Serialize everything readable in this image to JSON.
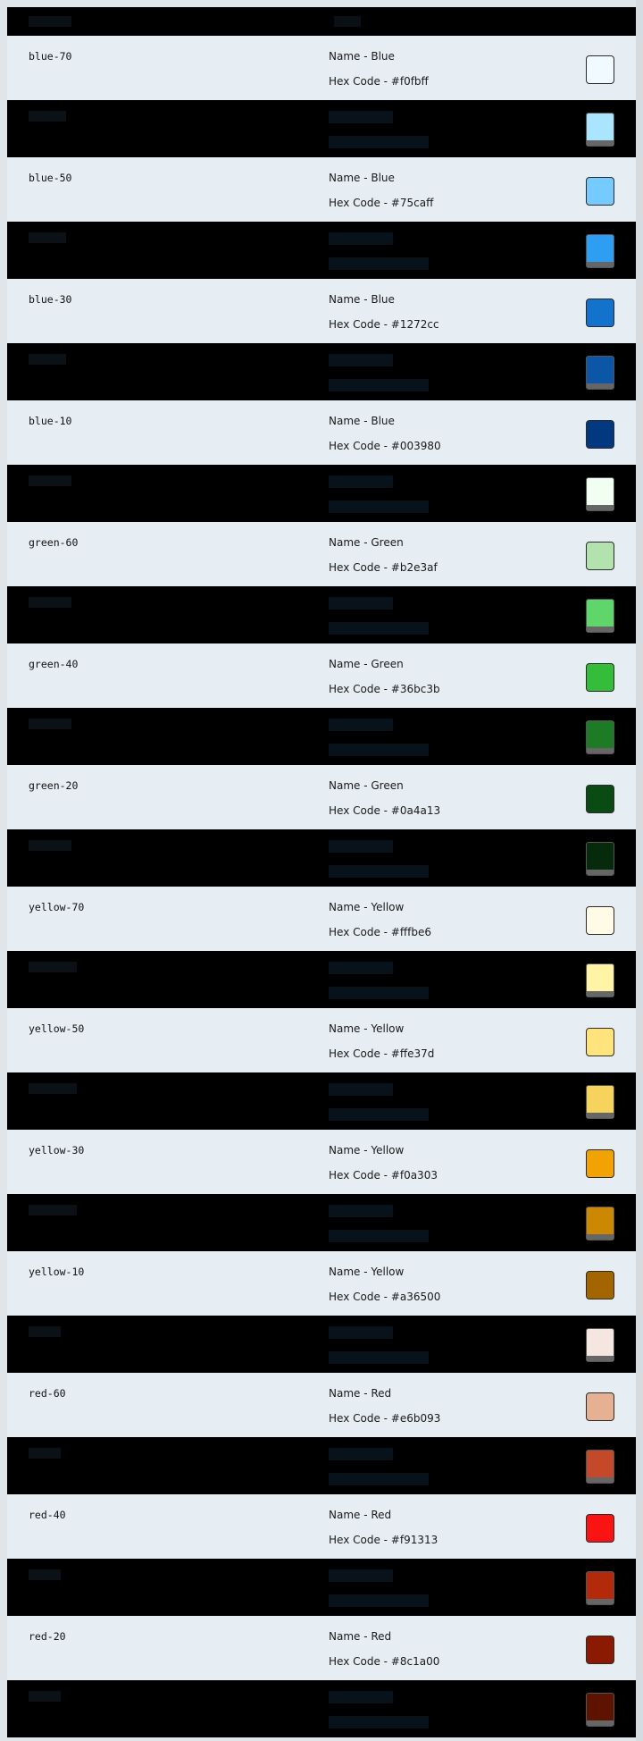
{
  "header": {
    "col1": "Token",
    "col2": "Value"
  },
  "rows": [
    {
      "token": "blue-70",
      "name": "Name - Blue",
      "hex": "Hex Code - #f0fbff",
      "color": "#f0fbff"
    },
    {
      "token": "blue-60",
      "name": "Name - Blue",
      "hex": "Hex Code - #a9e5ff",
      "color": "#a9e5ff",
      "dark": true
    },
    {
      "token": "blue-50",
      "name": "Name - Blue",
      "hex": "Hex Code - #75caff",
      "color": "#75caff"
    },
    {
      "token": "blue-40",
      "name": "Name - Blue",
      "hex": "Hex Code - #2d9ef2",
      "color": "#2d9ef2",
      "dark": true
    },
    {
      "token": "blue-30",
      "name": "Name - Blue",
      "hex": "Hex Code - #1272cc",
      "color": "#1272cc"
    },
    {
      "token": "blue-20",
      "name": "Name - Blue",
      "hex": "Hex Code - #0c56a8",
      "color": "#0c56a8",
      "dark": true
    },
    {
      "token": "blue-10",
      "name": "Name - Blue",
      "hex": "Hex Code - #003980",
      "color": "#003980"
    },
    {
      "token": "green-70",
      "name": "Name - Green",
      "hex": "Hex Code - #f0fff0",
      "color": "#f0fff0",
      "dark": true
    },
    {
      "token": "green-60",
      "name": "Name - Green",
      "hex": "Hex Code - #b2e3af",
      "color": "#b2e3af"
    },
    {
      "token": "green-50",
      "name": "Name - Green",
      "hex": "Hex Code - #5fd669",
      "color": "#5fd669",
      "dark": true
    },
    {
      "token": "green-40",
      "name": "Name - Green",
      "hex": "Hex Code - #36bc3b",
      "color": "#36bc3b"
    },
    {
      "token": "green-30",
      "name": "Name - Green",
      "hex": "Hex Code - #1d7a25",
      "color": "#1d7a25",
      "dark": true
    },
    {
      "token": "green-20",
      "name": "Name - Green",
      "hex": "Hex Code - #0a4a13",
      "color": "#0a4a13"
    },
    {
      "token": "green-10",
      "name": "Name - Green",
      "hex": "Hex Code - #062a0c",
      "color": "#062a0c",
      "dark": true
    },
    {
      "token": "yellow-70",
      "name": "Name - Yellow",
      "hex": "Hex Code - #fffbe6",
      "color": "#fffbe6"
    },
    {
      "token": "yellow-60",
      "name": "Name - Yellow",
      "hex": "Hex Code - #fff3a6",
      "color": "#fff3a6",
      "dark": true
    },
    {
      "token": "yellow-50",
      "name": "Name - Yellow",
      "hex": "Hex Code - #ffe37d",
      "color": "#ffe37d"
    },
    {
      "token": "yellow-40",
      "name": "Name - Yellow",
      "hex": "Hex Code - #f5d35c",
      "color": "#f5d35c",
      "dark": true
    },
    {
      "token": "yellow-30",
      "name": "Name - Yellow",
      "hex": "Hex Code - #f0a303",
      "color": "#f0a303"
    },
    {
      "token": "yellow-20",
      "name": "Name - Yellow",
      "hex": "Hex Code - #cc8800",
      "color": "#cc8800",
      "dark": true
    },
    {
      "token": "yellow-10",
      "name": "Name - Yellow",
      "hex": "Hex Code - #a36500",
      "color": "#a36500"
    },
    {
      "token": "red-70",
      "name": "Name - Red",
      "hex": "Hex Code - #f5e6df",
      "color": "#f5e6df",
      "dark": true
    },
    {
      "token": "red-60",
      "name": "Name - Red",
      "hex": "Hex Code - #e6b093",
      "color": "#e6b093"
    },
    {
      "token": "red-50",
      "name": "Name - Red",
      "hex": "Hex Code - #c4482a",
      "color": "#c4482a",
      "dark": true
    },
    {
      "token": "red-40",
      "name": "Name - Red",
      "hex": "Hex Code - #f91313",
      "color": "#f91313"
    },
    {
      "token": "red-30",
      "name": "Name - Red",
      "hex": "Hex Code - #b32a0a",
      "color": "#b32a0a",
      "dark": true
    },
    {
      "token": "red-20",
      "name": "Name - Red",
      "hex": "Hex Code - #8c1a00",
      "color": "#8c1a00"
    },
    {
      "token": "red-10",
      "name": "Name - Red",
      "hex": "Hex Code - #5e1300",
      "color": "#5e1300",
      "dark": true
    }
  ]
}
